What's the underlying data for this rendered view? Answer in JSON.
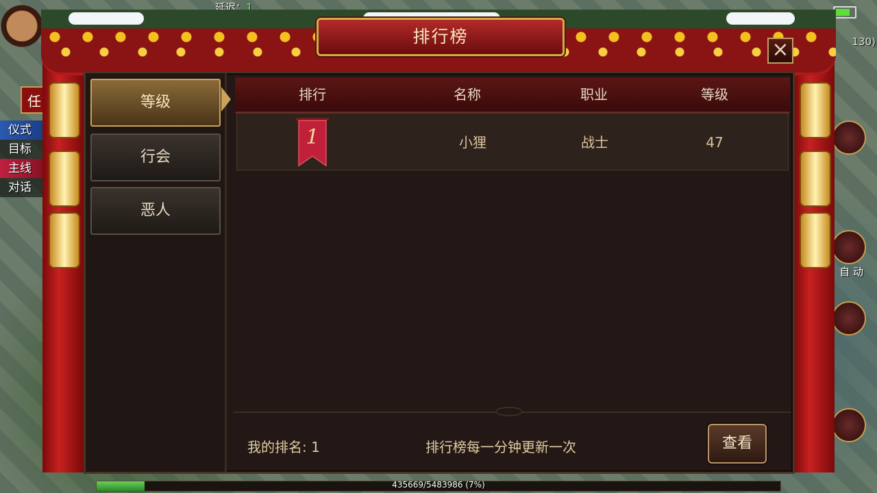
{
  "hud": {
    "latency_label": "延迟：",
    "latency_value": "1",
    "right_text": "130)",
    "quest_items": [
      "仪式",
      "目标",
      "主线",
      "对话"
    ],
    "left_tab_char": "任",
    "auto_label": "自 动",
    "exp_progress": 0.07,
    "exp_text": "435669/5483986 (7%)"
  },
  "panel": {
    "title": "排行榜",
    "close_icon": "close-icon",
    "tabs": [
      {
        "label": "等级",
        "active": true
      },
      {
        "label": "行会",
        "active": false
      },
      {
        "label": "恶人",
        "active": false
      }
    ],
    "columns": [
      "排行",
      "名称",
      "职业",
      "等级"
    ],
    "rows": [
      {
        "rank": "1",
        "name": "小狸",
        "class": "战士",
        "level": "47"
      }
    ],
    "my_rank_label": "我的排名: 1",
    "update_note": "排行榜每一分钟更新一次",
    "view_button": "查看"
  },
  "colors": {
    "title_bg": "#b22a2a",
    "active_tab": "#8a6a38",
    "panel_bg": "#231815",
    "rank_ribbon": "#c0203a"
  }
}
